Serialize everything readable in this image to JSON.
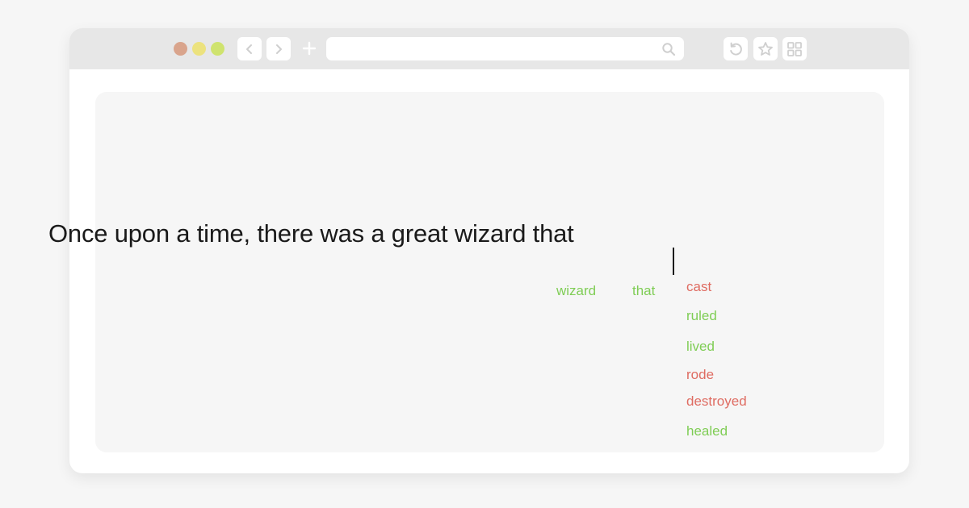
{
  "colors": {
    "page_background": "#f6f6f6",
    "toolbar_background": "#e7e7e7",
    "window_background": "#ffffff",
    "traffic_red": "#d9a48c",
    "traffic_yellow": "#ece27e",
    "traffic_green": "#cfe36e",
    "toolbar_icon": "#cfcfcf",
    "text_dark": "#1a1a1a",
    "prediction_green": "#7fcd55",
    "prediction_red": "#df6c62"
  },
  "toolbar": {
    "back_icon": "chevron-left-icon",
    "forward_icon": "chevron-right-icon",
    "new_tab_icon": "plus-icon",
    "address": {
      "value": "",
      "placeholder": ""
    },
    "search_icon": "search-icon",
    "reload_icon": "reload-icon",
    "bookmark_icon": "star-icon",
    "tabs_icon": "grid-icon"
  },
  "editor": {
    "sentence": "Once upon a time, there was a great wizard that"
  },
  "predictions": {
    "chosen": [
      {
        "word": "wizard",
        "color": "#7fcd55"
      },
      {
        "word": "that",
        "color": "#7fcd55"
      }
    ],
    "candidates": [
      {
        "word": "cast",
        "color": "#df6c62"
      },
      {
        "word": "ruled",
        "color": "#7fcd55"
      },
      {
        "word": "lived",
        "color": "#7fcd55"
      },
      {
        "word": "rode",
        "color": "#df6c62"
      },
      {
        "word": "destroyed",
        "color": "#df6c62"
      },
      {
        "word": "healed",
        "color": "#7fcd55"
      }
    ]
  }
}
